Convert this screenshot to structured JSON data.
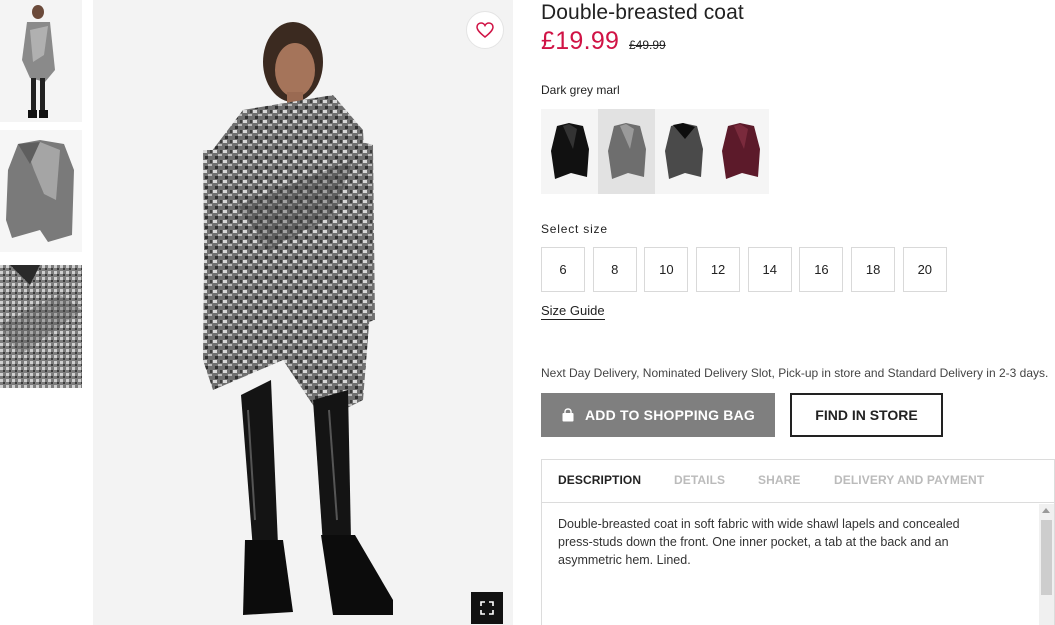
{
  "product": {
    "title": "Double-breasted coat",
    "price": "£19.99",
    "old_price": "£49.99"
  },
  "colors": {
    "selected_label": "Dark grey marl",
    "swatches": [
      {
        "name": "black-coat-swatch",
        "color": "#111111"
      },
      {
        "name": "dark-grey-marl-swatch",
        "color": "#6e6e6e",
        "selected": true
      },
      {
        "name": "grey-black-collar-swatch",
        "color": "#4a4a4a"
      },
      {
        "name": "burgundy-swatch",
        "color": "#5c1a2a"
      }
    ]
  },
  "sizes": {
    "label": "Select size",
    "options": [
      "6",
      "8",
      "10",
      "12",
      "14",
      "16",
      "18",
      "20"
    ],
    "guide_label": "Size Guide"
  },
  "delivery_text": "Next Day Delivery, Nominated Delivery Slot, Pick-up in store and Standard Delivery in 2-3 days.",
  "actions": {
    "add_to_bag": "ADD TO SHOPPING BAG",
    "find_in_store": "FIND IN STORE"
  },
  "tabs": [
    {
      "label": "DESCRIPTION",
      "active": true
    },
    {
      "label": "DETAILS"
    },
    {
      "label": "SHARE"
    },
    {
      "label": "DELIVERY AND PAYMENT"
    }
  ],
  "description": "Double-breasted coat in soft fabric with wide shawl lapels and concealed press-studs down the front. One inner pocket, a tab at the back and an asymmetric hem. Lined.",
  "icons": {
    "favorite": "heart-icon",
    "expand": "expand-icon",
    "bag": "shopping-bag-icon"
  },
  "theme": {
    "price_color": "#d01345",
    "button_grey": "#7f7f7f"
  }
}
